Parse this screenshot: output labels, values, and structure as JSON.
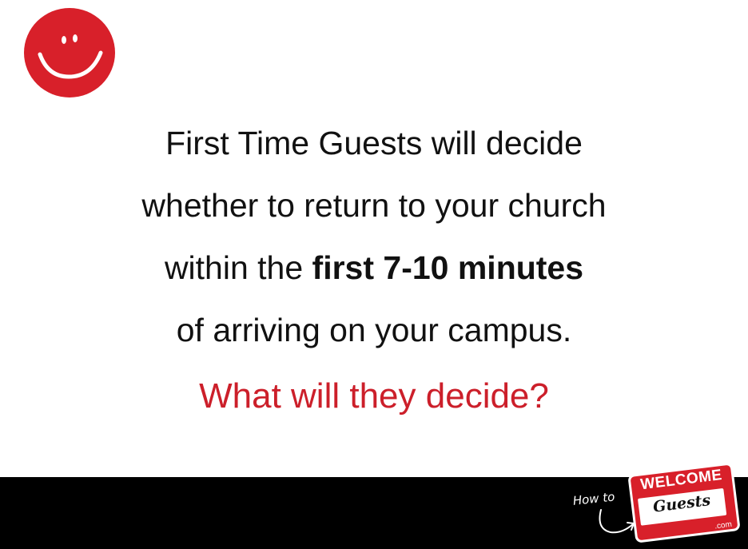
{
  "message": {
    "line1": "First Time Guests will decide",
    "line2": "whether to return to your church",
    "line3_prefix": "within the ",
    "line3_bold": "first 7-10 minutes",
    "line4": "of arriving on your campus."
  },
  "question": "What will they decide?",
  "branding": {
    "how_to": "How to",
    "badge_top": "WELCOME",
    "badge_name": "Guests",
    "badge_domain": ".com"
  },
  "colors": {
    "accent_red": "#cc1f2a",
    "smiley_red": "#d8202a",
    "text": "#111111",
    "footer": "#000000",
    "background": "#ffffff"
  },
  "icons": {
    "logo": "smiley-face-icon",
    "arrow": "curved-arrow-icon"
  }
}
